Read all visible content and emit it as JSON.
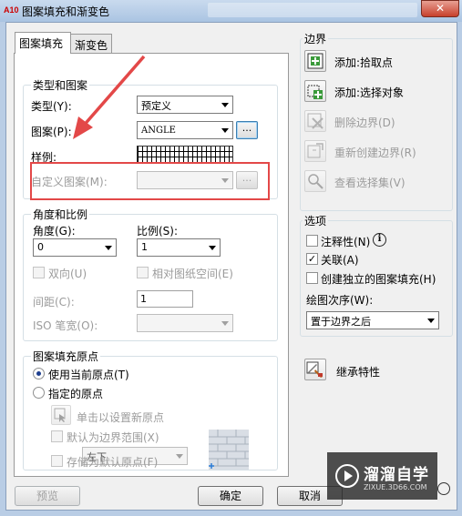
{
  "window": {
    "title": "图案填充和渐变色",
    "app_icon_text": "A10",
    "close_glyph": "✕"
  },
  "tabs": [
    {
      "label": "图案填充"
    },
    {
      "label": "渐变色"
    }
  ],
  "type_pattern": {
    "group_label": "类型和图案",
    "type_label": "类型(Y):",
    "type_value": "预定义",
    "pattern_label": "图案(P):",
    "pattern_value": "ANGLE",
    "pattern_browse": "...",
    "sample_label": "样例:",
    "custom_label": "自定义图案(M):",
    "custom_value": "",
    "custom_browse": "..."
  },
  "angle_scale": {
    "group_label": "角度和比例",
    "angle_label": "角度(G):",
    "angle_value": "0",
    "scale_label": "比例(S):",
    "scale_value": "1",
    "double_label": "双向(U)",
    "relative_label": "相对图纸空间(E)",
    "spacing_label": "间距(C):",
    "spacing_value": "1",
    "iso_label": "ISO 笔宽(O):",
    "iso_value": ""
  },
  "origin": {
    "group_label": "图案填充原点",
    "current_label": "使用当前原点(T)",
    "specified_label": "指定的原点",
    "click_set_label": "单击以设置新原点",
    "default_extent_label": "默认为边界范围(X)",
    "position_value": "左下",
    "store_default_label": "存储为默认原点(F)"
  },
  "boundary": {
    "group_label": "边界",
    "add_pick_label": "添加:拾取点",
    "add_select_label": "添加:选择对象",
    "remove_label": "删除边界(D)",
    "recreate_label": "重新创建边界(R)",
    "view_label": "查看选择集(V)"
  },
  "options": {
    "group_label": "选项",
    "annotative_label": "注释性(N)",
    "info_glyph": "i",
    "associative_label": "关联(A)",
    "check_glyph": "✓",
    "separate_label": "创建独立的图案填充(H)",
    "draw_order_label": "绘图次序(W):",
    "draw_order_value": "置于边界之后"
  },
  "inherit_label": "继承特性",
  "footer": {
    "preview": "预览",
    "ok": "确定",
    "cancel": "取消"
  },
  "watermark": {
    "brand": "溜溜自学",
    "url": "ZIXUE.3D66.COM"
  },
  "colors": {
    "annotation_red": "#e34848",
    "titlebar": "#b9cde5",
    "dialog_bg": "#f0f0f0"
  }
}
